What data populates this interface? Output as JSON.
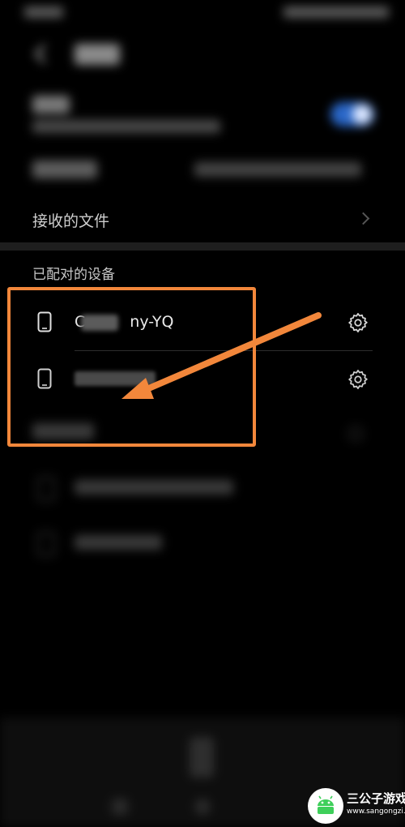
{
  "settings": {
    "received_files_label": "接收的文件",
    "paired_devices_title": "已配对的设备"
  },
  "paired_devices": [
    {
      "name_prefix": "C",
      "name_suffix": "ny-YQ",
      "icon": "phone-icon",
      "action_icon": "gear-icon"
    },
    {
      "name_prefix": "",
      "name_suffix": "",
      "icon": "phone-icon",
      "action_icon": "gear-icon"
    }
  ],
  "annotation": {
    "highlight_color": "#f2873b"
  },
  "watermark": {
    "brand": "三公子游戏网",
    "url": "www.sangongzi.net"
  },
  "colors": {
    "background": "#000000",
    "toggle_on": "#2a67c8",
    "accent_annotation": "#f2873b"
  }
}
